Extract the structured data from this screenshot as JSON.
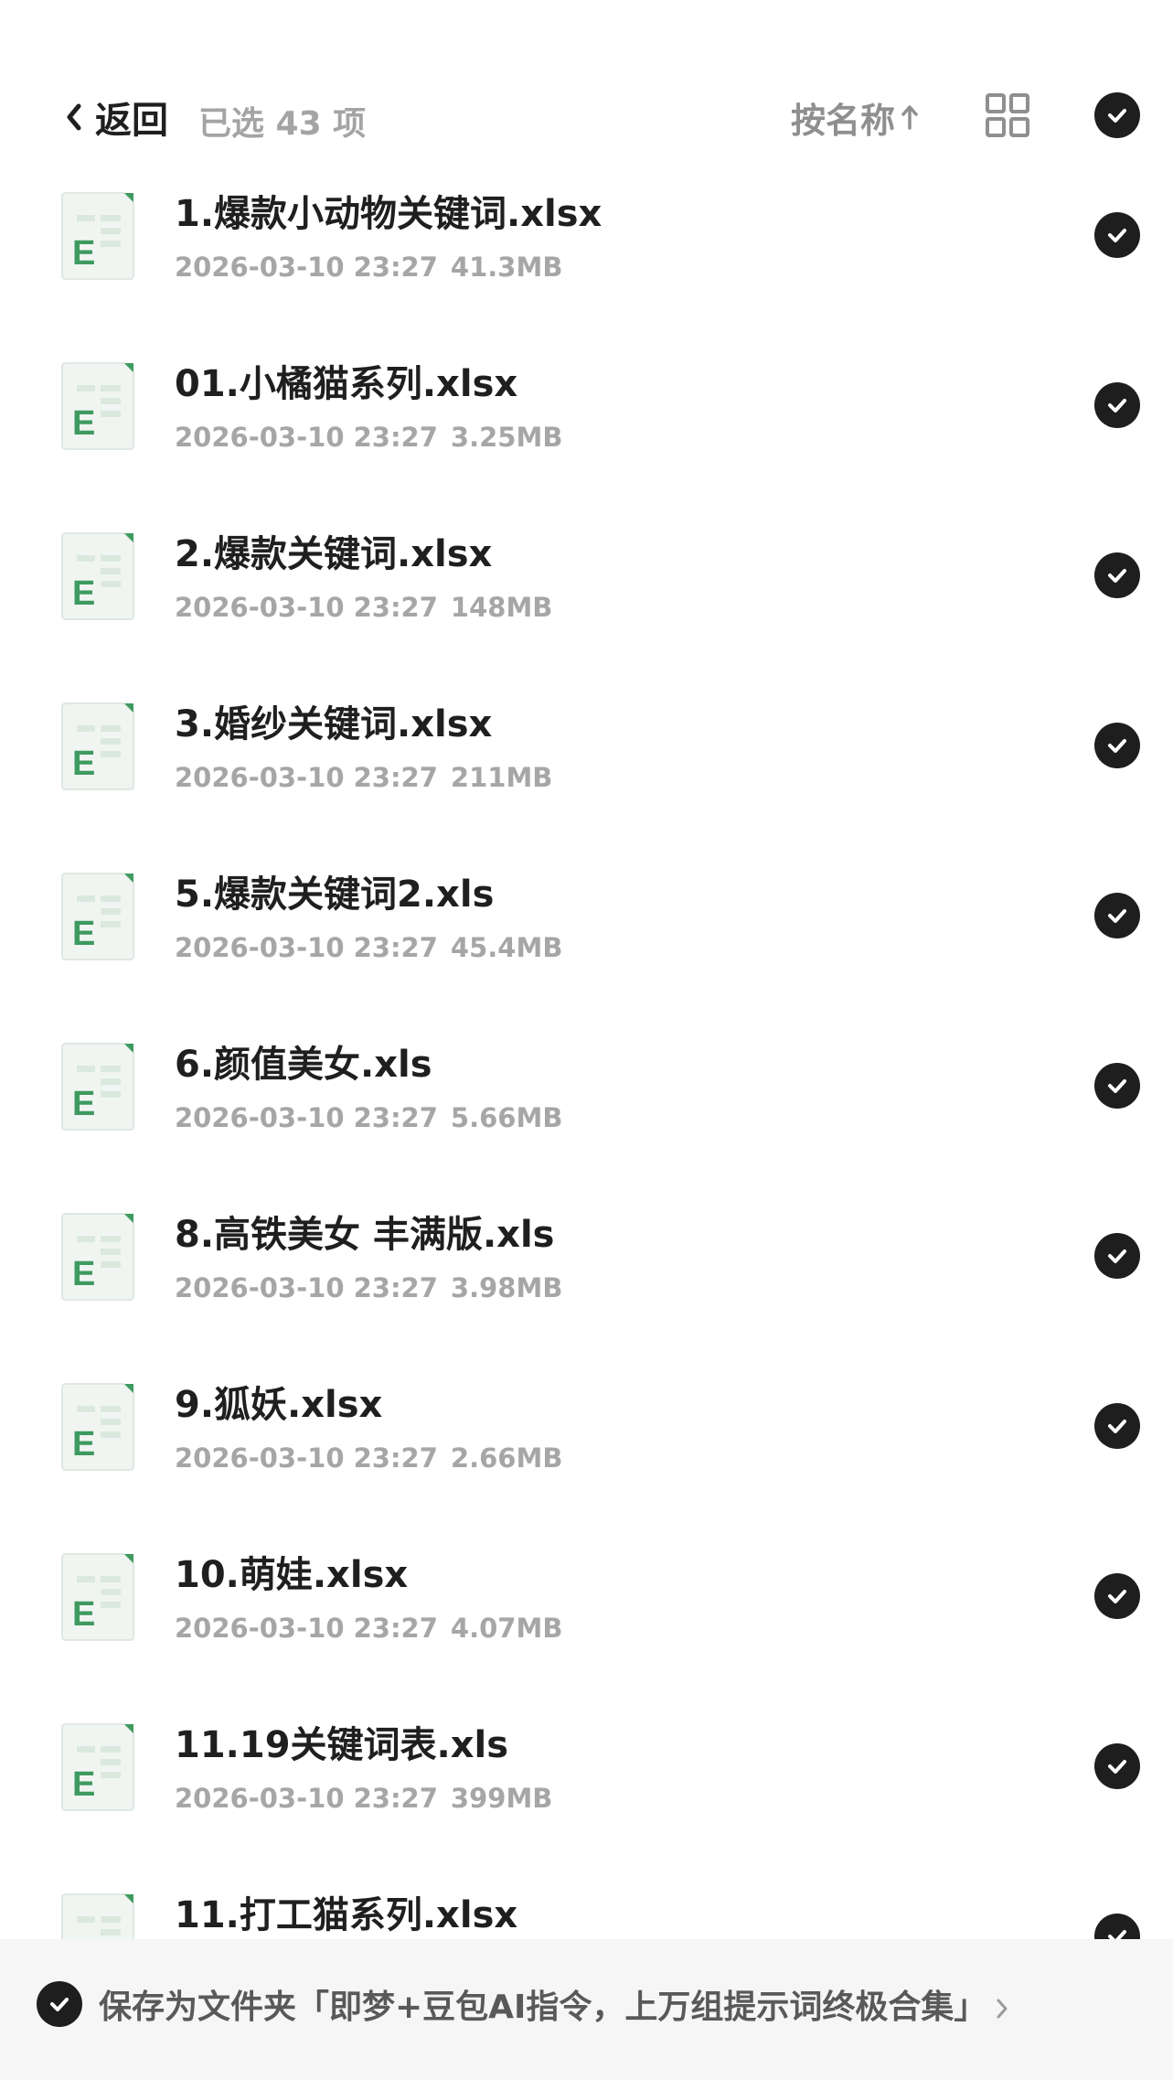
{
  "header": {
    "back_label": "返回",
    "selected_text": "已选 43 项",
    "sort_label": "按名称",
    "icons": {
      "back": "chevron-left-icon",
      "sort": "arrow-up-icon",
      "grid": "grid-view-icon",
      "select_all": "check-circle-icon"
    }
  },
  "files": [
    {
      "name": "1.爆款小动物关键词.xlsx",
      "date": "2026-03-10 23:27",
      "size": "41.3MB",
      "checked": true
    },
    {
      "name": "01.小橘猫系列.xlsx",
      "date": "2026-03-10 23:27",
      "size": "3.25MB",
      "checked": true
    },
    {
      "name": "2.爆款关键词.xlsx",
      "date": "2026-03-10 23:27",
      "size": "148MB",
      "checked": true
    },
    {
      "name": "3.婚纱关键词.xlsx",
      "date": "2026-03-10 23:27",
      "size": "211MB",
      "checked": true
    },
    {
      "name": "5.爆款关键词2.xls",
      "date": "2026-03-10 23:27",
      "size": "45.4MB",
      "checked": true
    },
    {
      "name": "6.颜值美女.xls",
      "date": "2026-03-10 23:27",
      "size": "5.66MB",
      "checked": true
    },
    {
      "name": "8.高铁美女 丰满版.xls",
      "date": "2026-03-10 23:27",
      "size": "3.98MB",
      "checked": true
    },
    {
      "name": "9.狐妖.xlsx",
      "date": "2026-03-10 23:27",
      "size": "2.66MB",
      "checked": true
    },
    {
      "name": "10.萌娃.xlsx",
      "date": "2026-03-10 23:27",
      "size": "4.07MB",
      "checked": true
    },
    {
      "name": "11.19关键词表.xls",
      "date": "2026-03-10 23:27",
      "size": "399MB",
      "checked": true
    },
    {
      "name": "11.打工猫系列.xlsx",
      "date": "",
      "size": "",
      "checked": true
    }
  ],
  "bottom_bar": {
    "label": "保存为文件夹「即梦+豆包AI指令，上万组提示词终极合集」",
    "checked": true
  },
  "colors": {
    "check_fill": "#1e1e1e",
    "excel_green": "#3e9a5f",
    "muted_text": "#a6a6a6",
    "bottom_bg": "#f6f6f6"
  }
}
